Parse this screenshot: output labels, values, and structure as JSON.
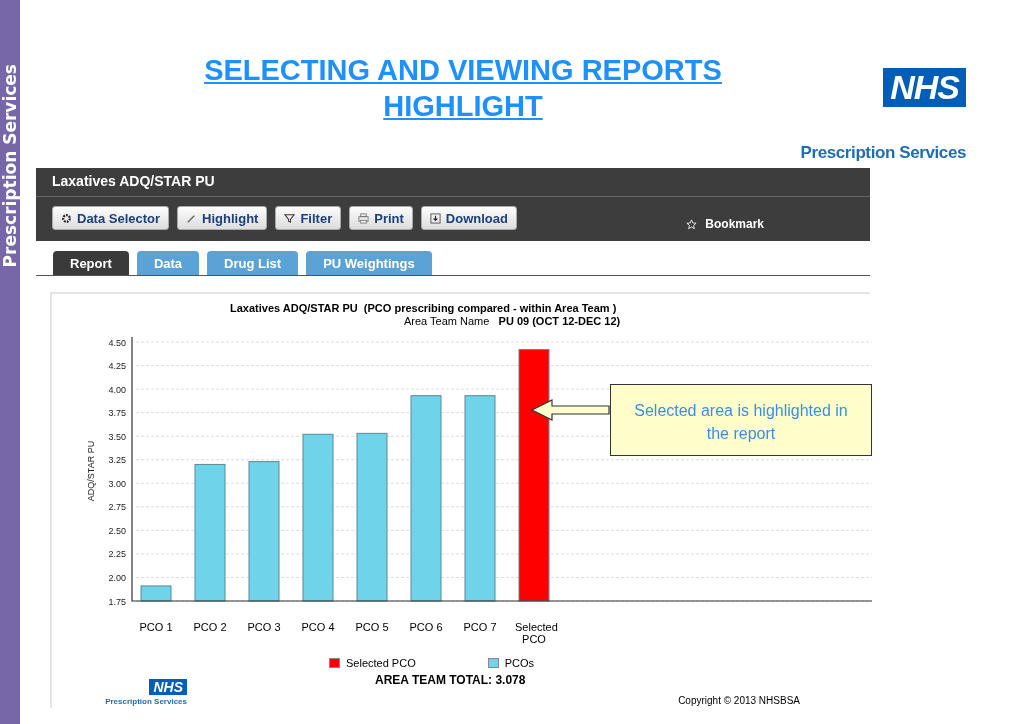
{
  "sidebar": {
    "title": "Prescription Services"
  },
  "header": {
    "title_lines": [
      "SELECTING AND VIEWING REPORTS",
      "HIGHLIGHT"
    ],
    "logo": "NHS",
    "logo_caption": "Prescription Services"
  },
  "app": {
    "report_title": "Laxatives ADQ/STAR PU",
    "toolbar": [
      {
        "label": "Data Selector",
        "kind": "gear"
      },
      {
        "label": "Highlight",
        "kind": "pencil"
      },
      {
        "label": "Filter",
        "kind": "filter"
      },
      {
        "label": "Print",
        "kind": "printer"
      },
      {
        "label": "Download",
        "kind": "download"
      }
    ],
    "bookmark": "Bookmark",
    "tabs": [
      {
        "label": "Report",
        "selected": true
      },
      {
        "label": "Data",
        "selected": false
      },
      {
        "label": "Drug List",
        "selected": false
      },
      {
        "label": "PU Weightings",
        "selected": false
      }
    ],
    "chart_subtitle": "Area Team Name   **PU 09 (OCT 12-DEC 12)**",
    "chart_data": {
      "type": "bar",
      "grid": true,
      "title": "Laxatives ADQ/STAR PU  (PCO prescribing compared - within Area Team )",
      "ylabel": "ADQ/STAR PU",
      "categories": [
        "PCO 1",
        "PCO 2",
        "PCO 3",
        "PCO 4",
        "PCO 5",
        "PCO 6",
        "PCO 7",
        "Selected PCO"
      ],
      "series": [
        {
          "name": "Selected PCO",
          "color": "#ff0000",
          "values": [
            null,
            null,
            null,
            null,
            null,
            null,
            null,
            4.42
          ]
        },
        {
          "name": "PCOs",
          "color": "#6fd3ea",
          "values": [
            1.91,
            3.2,
            3.23,
            3.52,
            3.53,
            3.93,
            3.93,
            null
          ]
        }
      ],
      "ylim": [
        1.75,
        4.5
      ],
      "yticks": [
        {
          "value": 1.75,
          "label": "1.75"
        },
        {
          "value": 2,
          "label": "2.00"
        },
        {
          "value": 2.25,
          "label": "2.25"
        },
        {
          "value": 2.5,
          "label": "2.50"
        },
        {
          "value": 2.75,
          "label": "2.75"
        },
        {
          "value": 3,
          "label": "3.00"
        },
        {
          "value": 3.25,
          "label": "3.25"
        },
        {
          "value": 3.5,
          "label": "3.50"
        },
        {
          "value": 3.75,
          "label": "3.75"
        },
        {
          "value": 4,
          "label": "4.00"
        },
        {
          "value": 4.25,
          "label": "4.25"
        },
        {
          "value": 4.5,
          "label": "4.50"
        }
      ]
    },
    "total": "AREA TEAM TOTAL: 3.078",
    "footer_logo": "NHS",
    "footer_caption": "Prescription Services",
    "copyright": "Copyright  © 2013 NHSBSA"
  },
  "callout": {
    "text": "Selected area is highlighted in the report"
  }
}
